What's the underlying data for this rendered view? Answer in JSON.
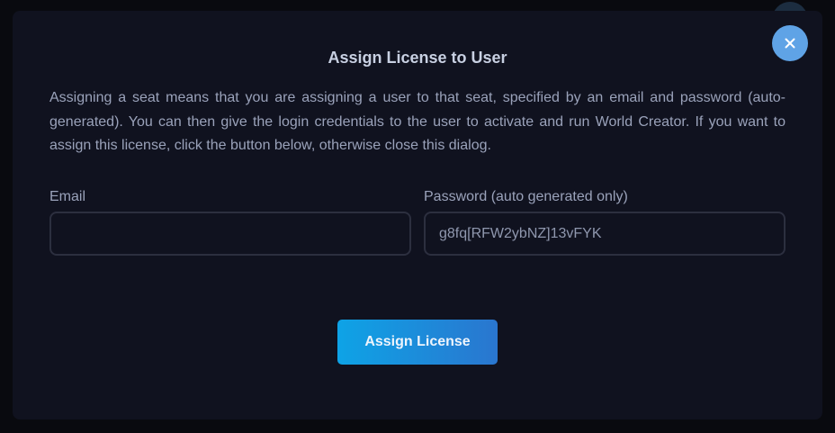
{
  "modal": {
    "title": "Assign License to User",
    "description": "Assigning a seat means that you are assigning a user to that seat, specified by an email and password (auto-generated). You can then give the login credentials to the user to activate and run World Creator. If you want to assign this license, click the button below, otherwise close this dialog.",
    "close_icon": "close-icon",
    "email": {
      "label": "Email",
      "value": "",
      "placeholder": ""
    },
    "password": {
      "label": "Password (auto generated only)",
      "value": "g8fq[RFW2ybNZ]13vFYK"
    },
    "assign_button_label": "Assign License"
  },
  "colors": {
    "backdrop": "#090a0f",
    "modal_bg": "#10121f",
    "close_button": "#5fa3e6",
    "button_gradient_start": "#0ea3e6",
    "button_gradient_end": "#2a76cf",
    "text_primary": "#c8d0e2",
    "text_secondary": "#9aa2ba"
  }
}
